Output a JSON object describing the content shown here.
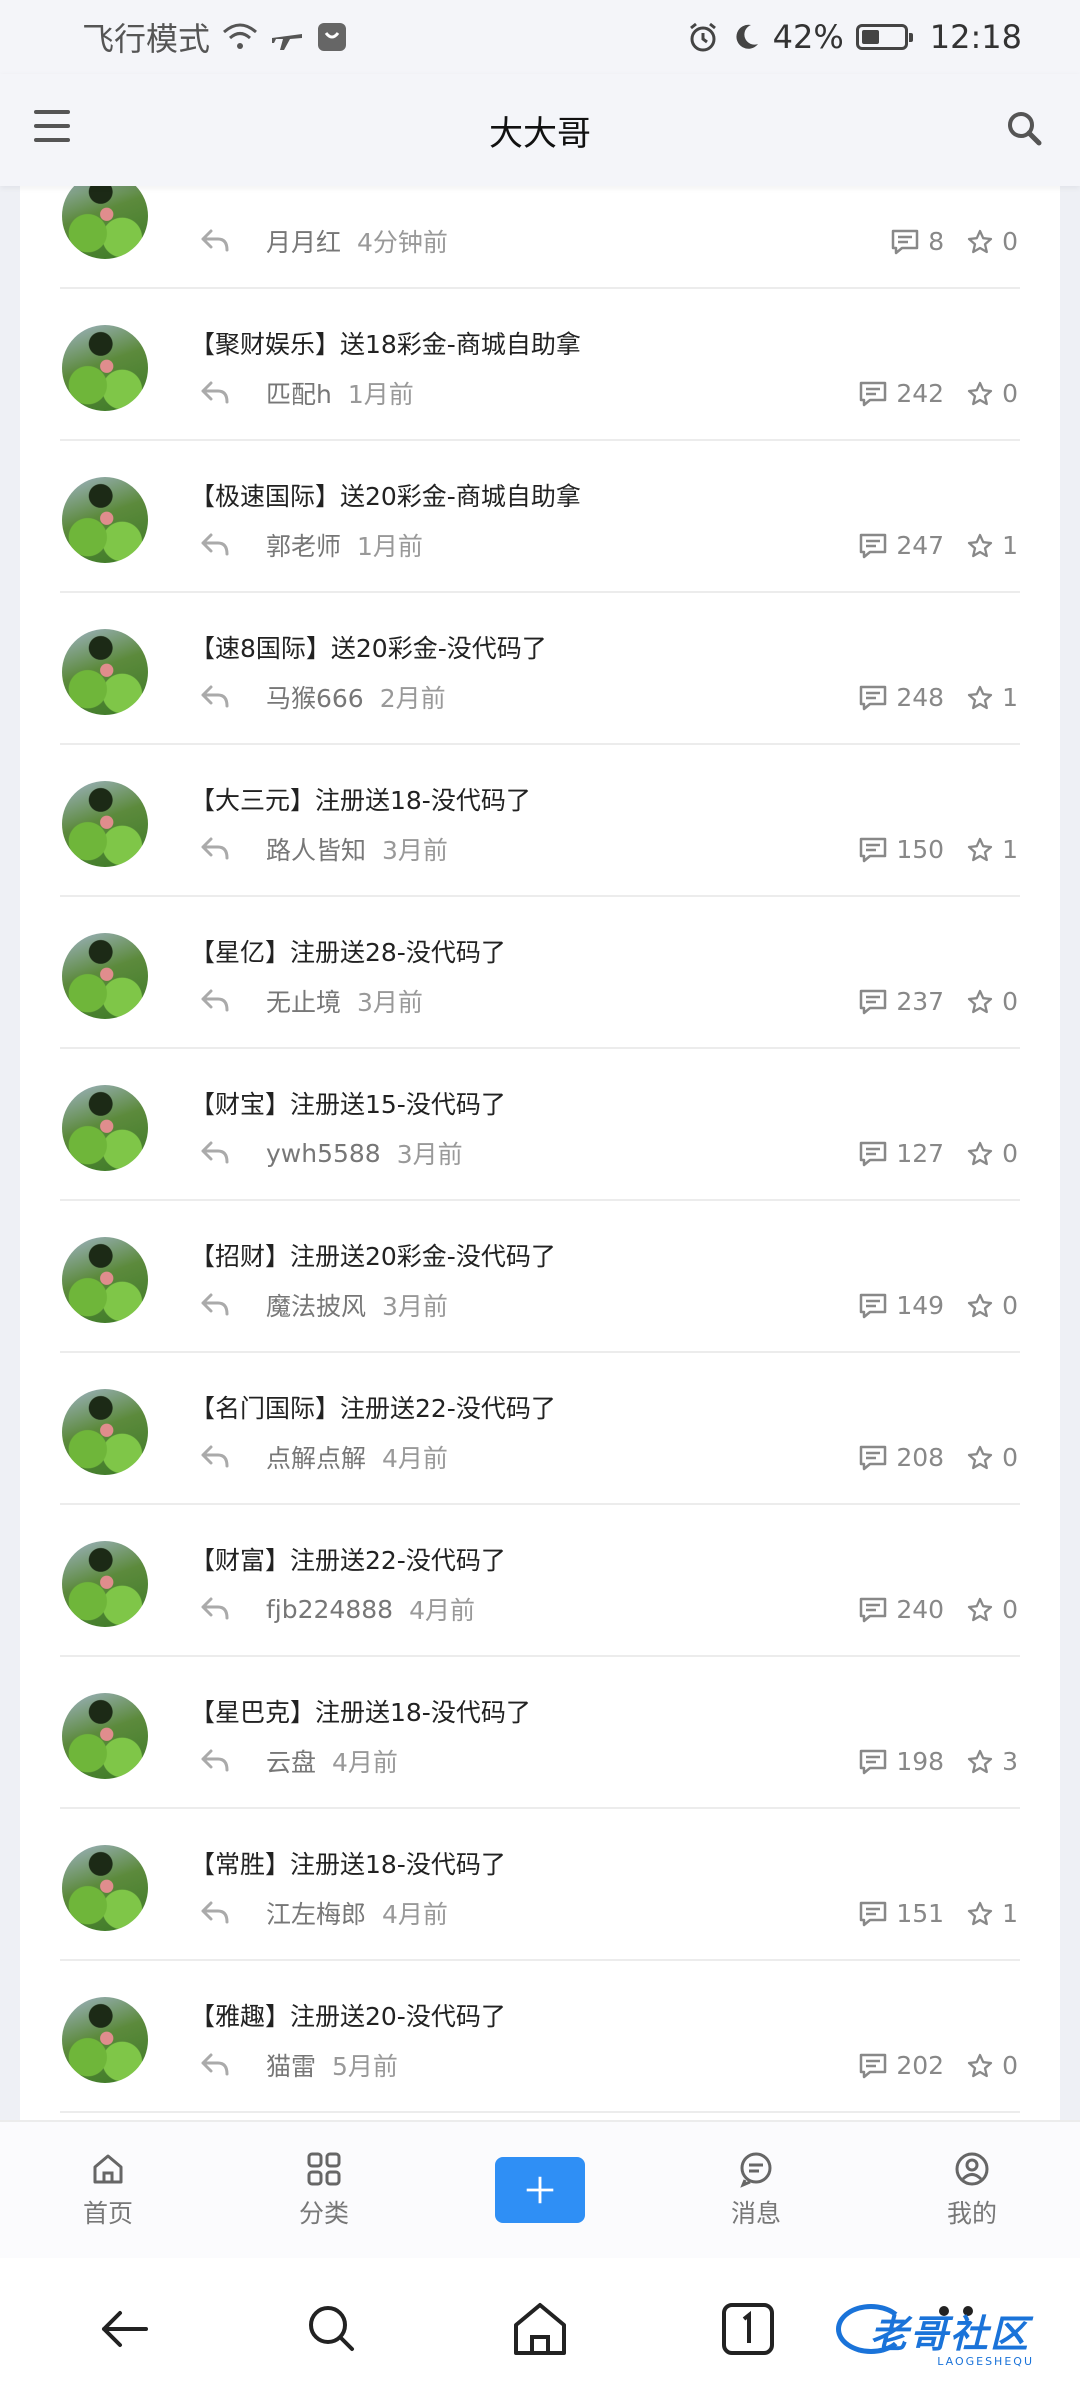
{
  "status_bar": {
    "mode": "飞行模式",
    "battery": "42%",
    "battery_level": 0.42,
    "time": "12:18"
  },
  "header": {
    "title": "大大哥"
  },
  "posts": [
    {
      "title": "",
      "author": "月月红",
      "time": "4分钟前",
      "comments": "8",
      "stars": "0"
    },
    {
      "title": "【聚财娱乐】送18彩金-商城自助拿",
      "author": "匹配h",
      "time": "1月前",
      "comments": "242",
      "stars": "0"
    },
    {
      "title": "【极速国际】送20彩金-商城自助拿",
      "author": "郭老师",
      "time": "1月前",
      "comments": "247",
      "stars": "1"
    },
    {
      "title": "【速8国际】送20彩金-没代码了",
      "author": "马猴666",
      "time": "2月前",
      "comments": "248",
      "stars": "1"
    },
    {
      "title": "【大三元】注册送18-没代码了",
      "author": "路人皆知",
      "time": "3月前",
      "comments": "150",
      "stars": "1"
    },
    {
      "title": "【星亿】注册送28-没代码了",
      "author": "无止境",
      "time": "3月前",
      "comments": "237",
      "stars": "0"
    },
    {
      "title": "【财宝】注册送15-没代码了",
      "author": "ywh5588",
      "time": "3月前",
      "comments": "127",
      "stars": "0"
    },
    {
      "title": "【招财】注册送20彩金-没代码了",
      "author": "魔法披风",
      "time": "3月前",
      "comments": "149",
      "stars": "0"
    },
    {
      "title": "【名门国际】注册送22-没代码了",
      "author": "点解点解",
      "time": "4月前",
      "comments": "208",
      "stars": "0"
    },
    {
      "title": "【财富】注册送22-没代码了",
      "author": "fjb224888",
      "time": "4月前",
      "comments": "240",
      "stars": "0"
    },
    {
      "title": "【星巴克】注册送18-没代码了",
      "author": "云盘",
      "time": "4月前",
      "comments": "198",
      "stars": "3"
    },
    {
      "title": "【常胜】注册送18-没代码了",
      "author": "江左梅郎",
      "time": "4月前",
      "comments": "151",
      "stars": "1"
    },
    {
      "title": "【雅趣】注册送20-没代码了",
      "author": "猫雷",
      "time": "5月前",
      "comments": "202",
      "stars": "0"
    }
  ],
  "tab_bar": {
    "home": "首页",
    "category": "分类",
    "messages": "消息",
    "mine": "我的"
  },
  "watermark": {
    "text": "老哥社区",
    "sub": "LAOGESHEQU"
  },
  "colors": {
    "accent": "#2f8ff5",
    "watermark": "#1a73d9"
  }
}
